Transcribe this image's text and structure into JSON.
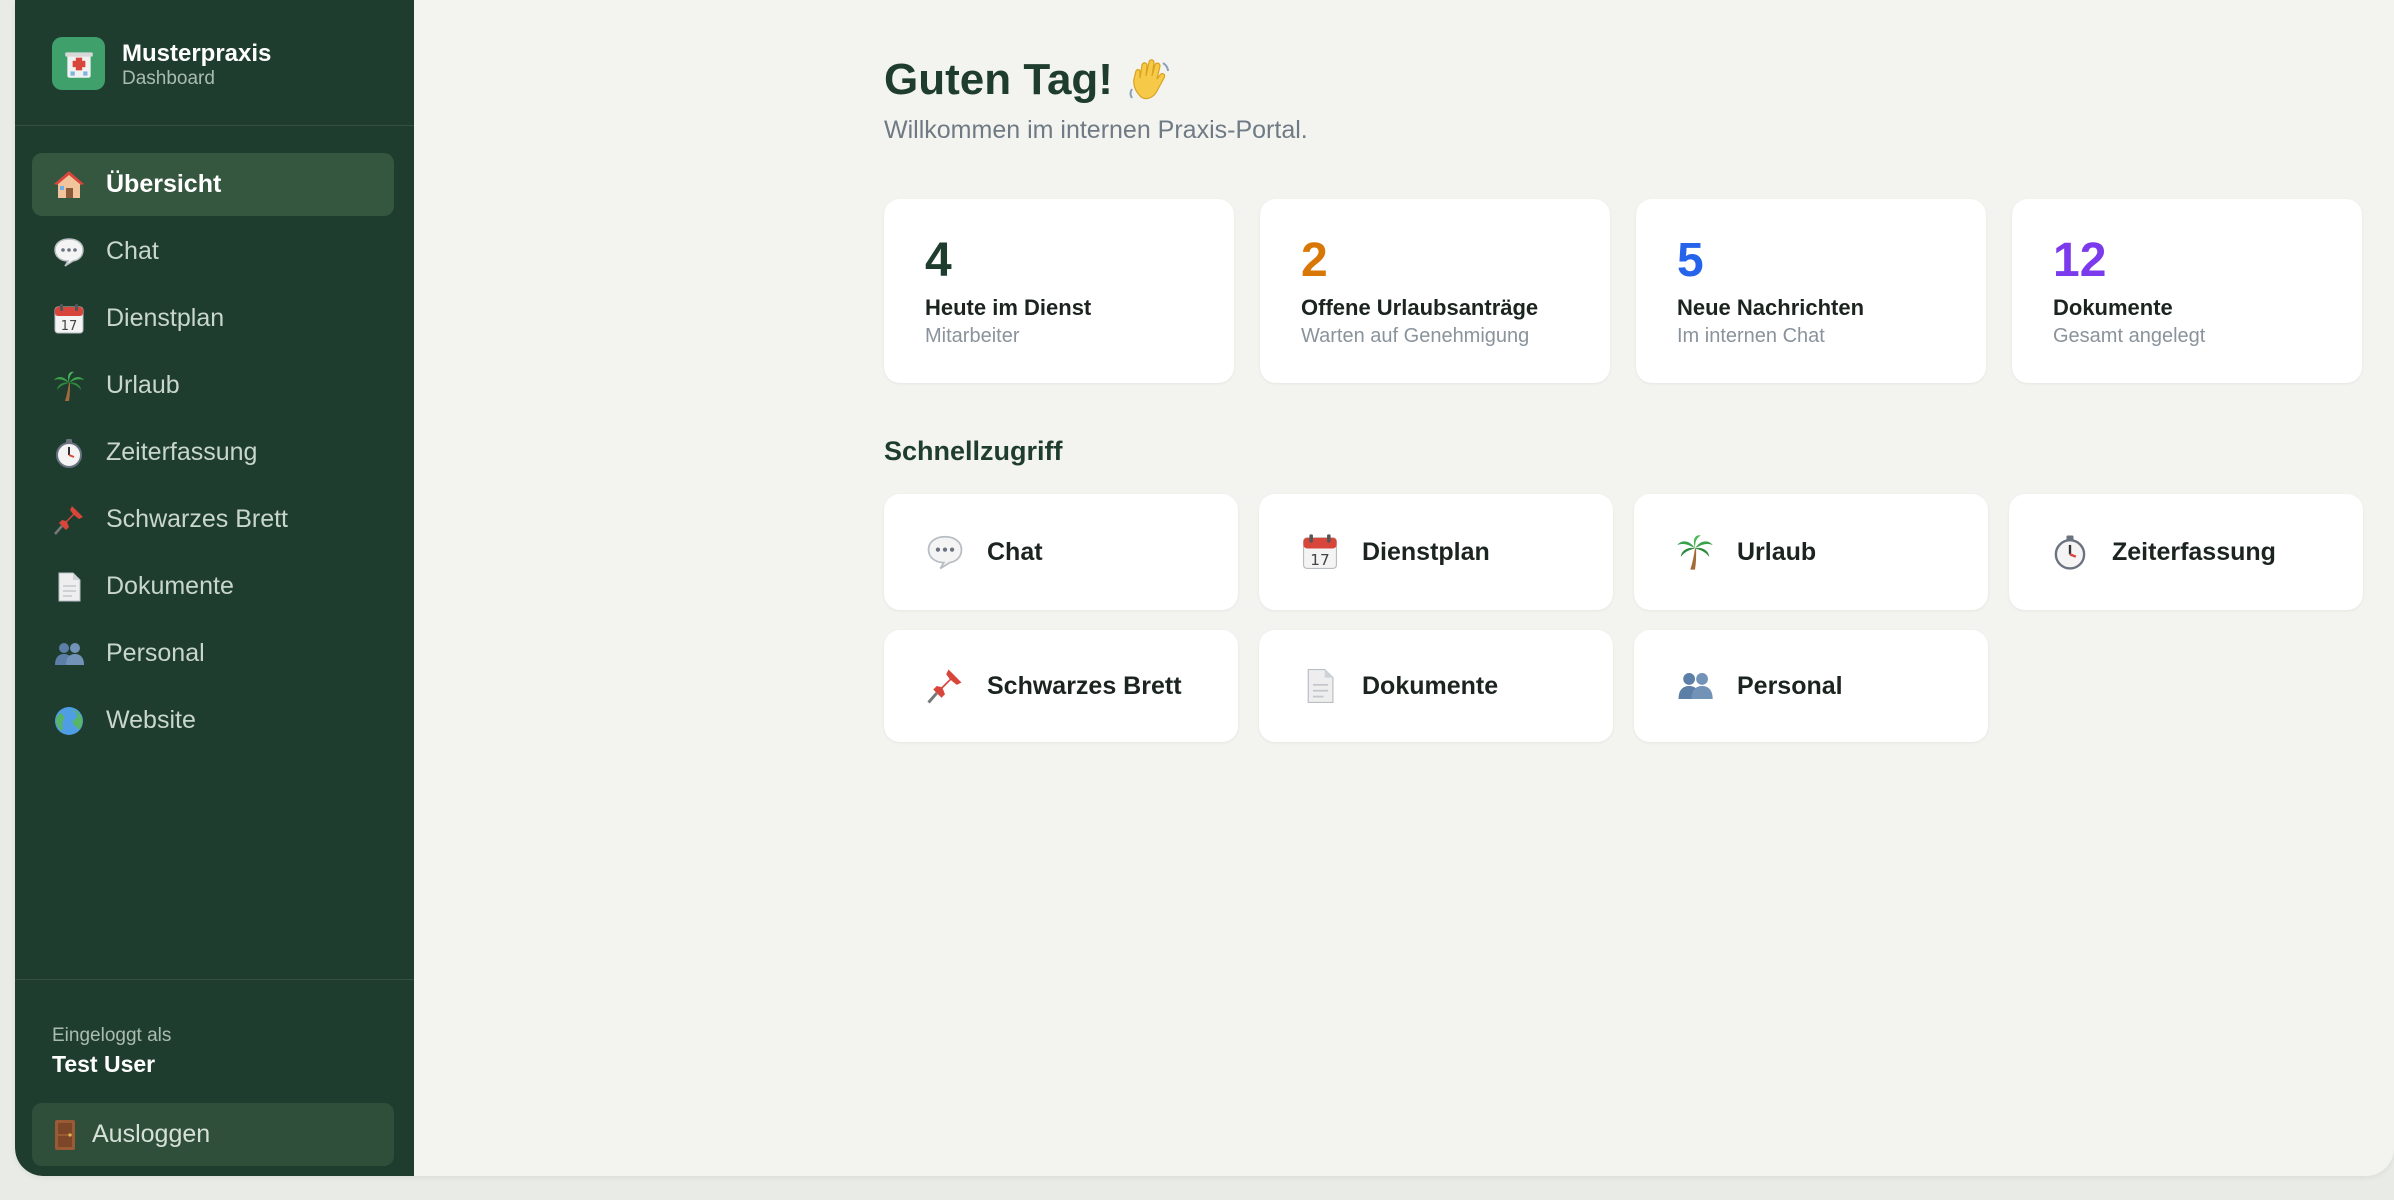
{
  "sidebar": {
    "brand_title": "Musterpraxis",
    "brand_subtitle": "Dashboard",
    "items": [
      {
        "label": "Übersicht",
        "icon": "house-icon",
        "active": true
      },
      {
        "label": "Chat",
        "icon": "speech-bubble-icon"
      },
      {
        "label": "Dienstplan",
        "icon": "calendar-icon"
      },
      {
        "label": "Urlaub",
        "icon": "palm-tree-icon"
      },
      {
        "label": "Zeiterfassung",
        "icon": "stopwatch-icon"
      },
      {
        "label": "Schwarzes Brett",
        "icon": "pushpin-icon"
      },
      {
        "label": "Dokumente",
        "icon": "document-icon"
      },
      {
        "label": "Personal",
        "icon": "people-icon"
      },
      {
        "label": "Website",
        "icon": "globe-icon"
      }
    ],
    "logged_in_label": "Eingeloggt als",
    "logged_in_user": "Test User",
    "logout_label": "Ausloggen"
  },
  "main": {
    "greeting": "Guten Tag!",
    "subtitle": "Willkommen im internen Praxis-Portal.",
    "stats": [
      {
        "value": "4",
        "label": "Heute im Dienst",
        "sub": "Mitarbeiter",
        "color": "#1f3d2e"
      },
      {
        "value": "2",
        "label": "Offene Urlaubsanträge",
        "sub": "Warten auf Genehmigung",
        "color": "#d97706"
      },
      {
        "value": "5",
        "label": "Neue Nachrichten",
        "sub": "Im internen Chat",
        "color": "#2563eb"
      },
      {
        "value": "12",
        "label": "Dokumente",
        "sub": "Gesamt angelegt",
        "color": "#7c3aed"
      }
    ],
    "quick_title": "Schnellzugriff",
    "quick": [
      {
        "label": "Chat",
        "icon": "speech-bubble-icon"
      },
      {
        "label": "Dienstplan",
        "icon": "calendar-icon"
      },
      {
        "label": "Urlaub",
        "icon": "palm-tree-icon"
      },
      {
        "label": "Zeiterfassung",
        "icon": "stopwatch-icon"
      },
      {
        "label": "Schwarzes Brett",
        "icon": "pushpin-icon"
      },
      {
        "label": "Dokumente",
        "icon": "document-icon"
      },
      {
        "label": "Personal",
        "icon": "people-icon"
      }
    ]
  },
  "colors": {
    "sidebar_bg": "#1f3d2e",
    "sidebar_active": "#35573f",
    "page_bg": "#f3f4ef",
    "accent_green": "#3fa06c"
  }
}
